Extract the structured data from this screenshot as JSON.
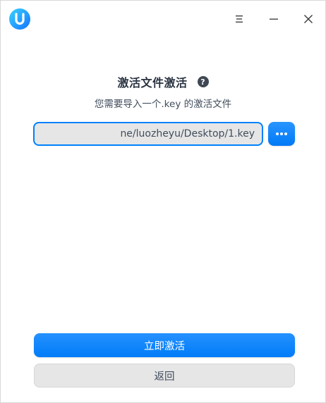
{
  "titlebar": {
    "logo_icon": "app-logo-icon",
    "menu_icon": "menu-icon",
    "minimize_icon": "minimize-icon",
    "close_icon": "close-icon"
  },
  "header": {
    "title": "激活文件激活",
    "help_glyph": "?",
    "subtitle": "您需要导入一个.key 的激活文件"
  },
  "file_input": {
    "value": "ne/luozheyu/Desktop/1.key",
    "browse_icon": "more-dots-icon"
  },
  "actions": {
    "activate_label": "立即激活",
    "back_label": "返回"
  },
  "colors": {
    "accent": "#0081ff",
    "title_text": "#2b3442",
    "body_text": "#414d5c",
    "input_bg": "#e6e6e6"
  }
}
